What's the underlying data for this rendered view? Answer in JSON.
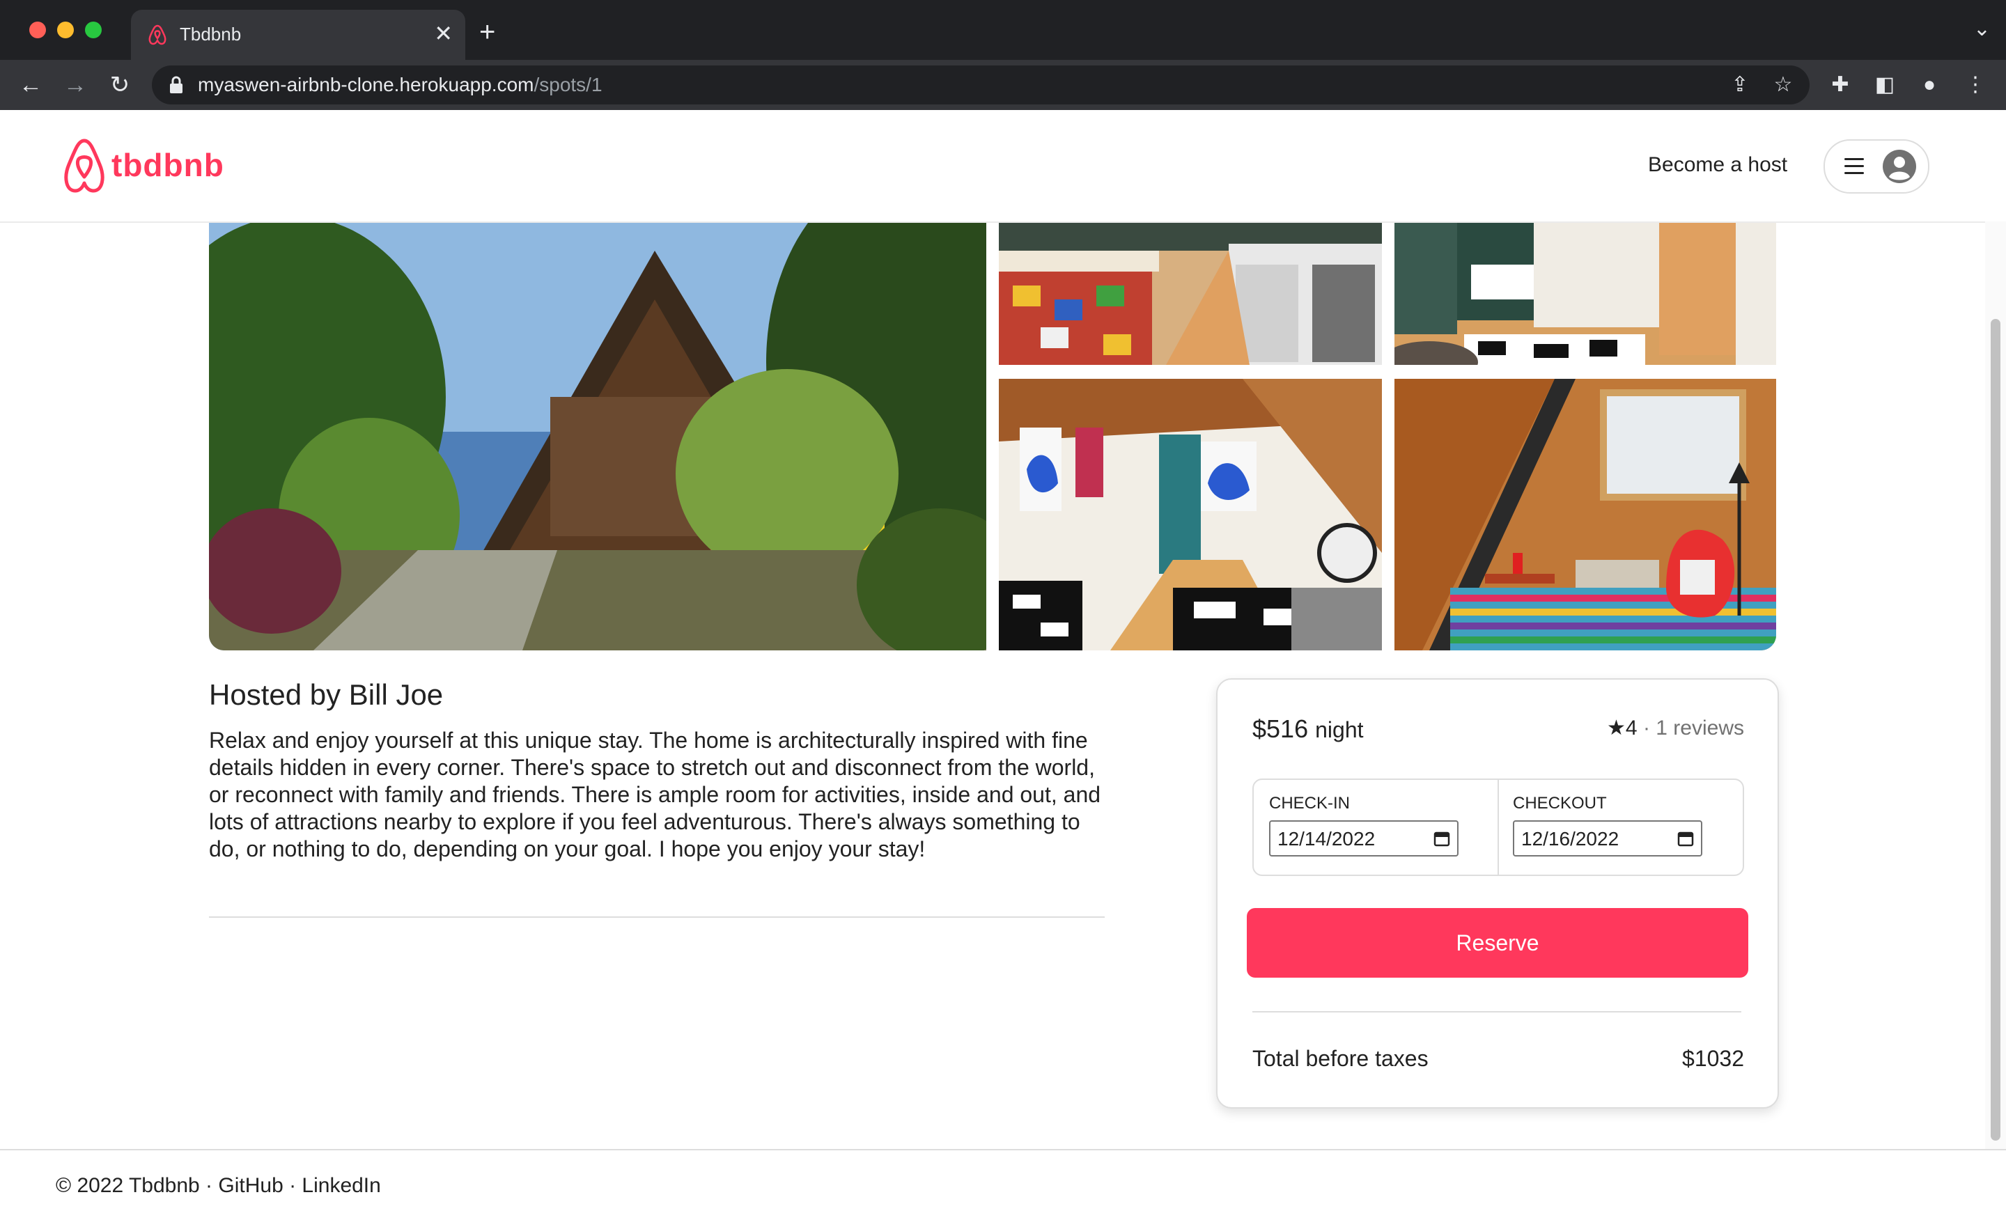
{
  "browser": {
    "tab_title": "Tbdbnb",
    "tab_close": "✕",
    "new_tab": "+",
    "url_domain": "myaswen-airbnb-clone.herokuapp.com",
    "url_path": "/spots/1"
  },
  "header": {
    "logo_text": "tbdbnb",
    "become_host": "Become a host"
  },
  "listing": {
    "host_title": "Hosted by Bill Joe",
    "description": "Relax and enjoy yourself at this unique stay. The home is architecturally inspired with fine details hidden in every corner. There's space to stretch out and disconnect from the world, or reconnect with family and friends. There is ample room for activities, inside and out, and lots of attractions nearby to explore if you feel adventurous. There's always something to do, or nothing to do, depending on your goal. I hope you enjoy your stay!"
  },
  "booking": {
    "price": "$516",
    "price_unit": "night",
    "rating": "4",
    "reviews": "· 1 reviews",
    "checkin_label": "CHECK-IN",
    "checkin_value": "12/14/2022",
    "checkout_label": "CHECKOUT",
    "checkout_value": "12/16/2022",
    "reserve_label": "Reserve",
    "total_label": "Total before taxes",
    "total_value": "$1032"
  },
  "footer": {
    "text": "© 2022 Tbdbnb · GitHub · LinkedIn"
  },
  "colors": {
    "brand": "#ff385c",
    "chrome_dark": "#202124",
    "chrome_toolbar": "#35363a"
  },
  "icons": [
    "close-window-dot",
    "minimize-window-dot",
    "maximize-window-dot",
    "airbnb-logo-icon",
    "back-arrow-icon",
    "forward-arrow-icon",
    "reload-icon",
    "lock-icon",
    "share-icon",
    "star-bookmark-icon",
    "extensions-icon",
    "sidebar-icon",
    "profile-icon",
    "kebab-menu-icon",
    "hamburger-menu-icon",
    "user-avatar-icon",
    "star-icon",
    "calendar-icon"
  ]
}
